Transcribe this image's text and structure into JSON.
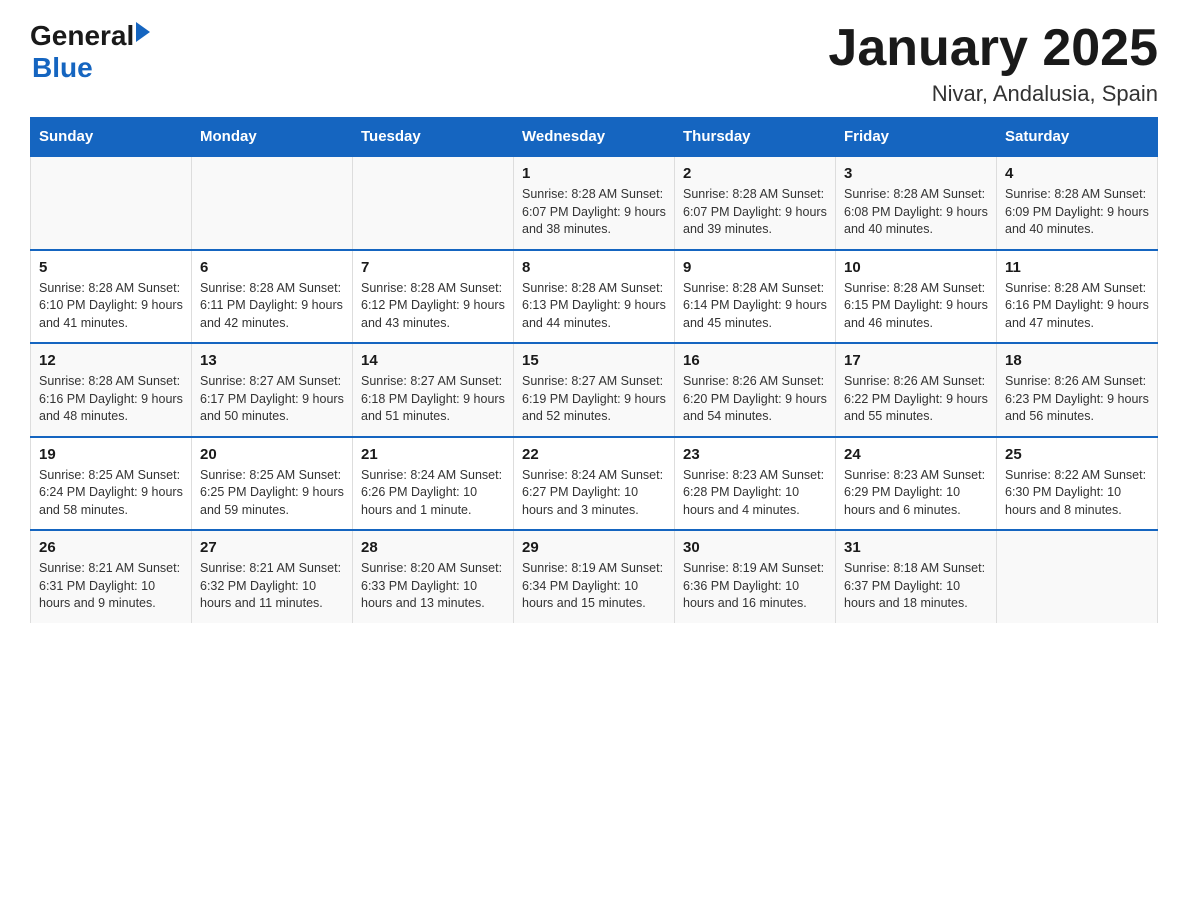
{
  "header": {
    "logo_general": "General",
    "logo_blue": "Blue",
    "title": "January 2025",
    "subtitle": "Nivar, Andalusia, Spain"
  },
  "days_of_week": [
    "Sunday",
    "Monday",
    "Tuesday",
    "Wednesday",
    "Thursday",
    "Friday",
    "Saturday"
  ],
  "weeks": [
    {
      "cells": [
        {
          "day": "",
          "info": ""
        },
        {
          "day": "",
          "info": ""
        },
        {
          "day": "",
          "info": ""
        },
        {
          "day": "1",
          "info": "Sunrise: 8:28 AM\nSunset: 6:07 PM\nDaylight: 9 hours\nand 38 minutes."
        },
        {
          "day": "2",
          "info": "Sunrise: 8:28 AM\nSunset: 6:07 PM\nDaylight: 9 hours\nand 39 minutes."
        },
        {
          "day": "3",
          "info": "Sunrise: 8:28 AM\nSunset: 6:08 PM\nDaylight: 9 hours\nand 40 minutes."
        },
        {
          "day": "4",
          "info": "Sunrise: 8:28 AM\nSunset: 6:09 PM\nDaylight: 9 hours\nand 40 minutes."
        }
      ]
    },
    {
      "cells": [
        {
          "day": "5",
          "info": "Sunrise: 8:28 AM\nSunset: 6:10 PM\nDaylight: 9 hours\nand 41 minutes."
        },
        {
          "day": "6",
          "info": "Sunrise: 8:28 AM\nSunset: 6:11 PM\nDaylight: 9 hours\nand 42 minutes."
        },
        {
          "day": "7",
          "info": "Sunrise: 8:28 AM\nSunset: 6:12 PM\nDaylight: 9 hours\nand 43 minutes."
        },
        {
          "day": "8",
          "info": "Sunrise: 8:28 AM\nSunset: 6:13 PM\nDaylight: 9 hours\nand 44 minutes."
        },
        {
          "day": "9",
          "info": "Sunrise: 8:28 AM\nSunset: 6:14 PM\nDaylight: 9 hours\nand 45 minutes."
        },
        {
          "day": "10",
          "info": "Sunrise: 8:28 AM\nSunset: 6:15 PM\nDaylight: 9 hours\nand 46 minutes."
        },
        {
          "day": "11",
          "info": "Sunrise: 8:28 AM\nSunset: 6:16 PM\nDaylight: 9 hours\nand 47 minutes."
        }
      ]
    },
    {
      "cells": [
        {
          "day": "12",
          "info": "Sunrise: 8:28 AM\nSunset: 6:16 PM\nDaylight: 9 hours\nand 48 minutes."
        },
        {
          "day": "13",
          "info": "Sunrise: 8:27 AM\nSunset: 6:17 PM\nDaylight: 9 hours\nand 50 minutes."
        },
        {
          "day": "14",
          "info": "Sunrise: 8:27 AM\nSunset: 6:18 PM\nDaylight: 9 hours\nand 51 minutes."
        },
        {
          "day": "15",
          "info": "Sunrise: 8:27 AM\nSunset: 6:19 PM\nDaylight: 9 hours\nand 52 minutes."
        },
        {
          "day": "16",
          "info": "Sunrise: 8:26 AM\nSunset: 6:20 PM\nDaylight: 9 hours\nand 54 minutes."
        },
        {
          "day": "17",
          "info": "Sunrise: 8:26 AM\nSunset: 6:22 PM\nDaylight: 9 hours\nand 55 minutes."
        },
        {
          "day": "18",
          "info": "Sunrise: 8:26 AM\nSunset: 6:23 PM\nDaylight: 9 hours\nand 56 minutes."
        }
      ]
    },
    {
      "cells": [
        {
          "day": "19",
          "info": "Sunrise: 8:25 AM\nSunset: 6:24 PM\nDaylight: 9 hours\nand 58 minutes."
        },
        {
          "day": "20",
          "info": "Sunrise: 8:25 AM\nSunset: 6:25 PM\nDaylight: 9 hours\nand 59 minutes."
        },
        {
          "day": "21",
          "info": "Sunrise: 8:24 AM\nSunset: 6:26 PM\nDaylight: 10 hours\nand 1 minute."
        },
        {
          "day": "22",
          "info": "Sunrise: 8:24 AM\nSunset: 6:27 PM\nDaylight: 10 hours\nand 3 minutes."
        },
        {
          "day": "23",
          "info": "Sunrise: 8:23 AM\nSunset: 6:28 PM\nDaylight: 10 hours\nand 4 minutes."
        },
        {
          "day": "24",
          "info": "Sunrise: 8:23 AM\nSunset: 6:29 PM\nDaylight: 10 hours\nand 6 minutes."
        },
        {
          "day": "25",
          "info": "Sunrise: 8:22 AM\nSunset: 6:30 PM\nDaylight: 10 hours\nand 8 minutes."
        }
      ]
    },
    {
      "cells": [
        {
          "day": "26",
          "info": "Sunrise: 8:21 AM\nSunset: 6:31 PM\nDaylight: 10 hours\nand 9 minutes."
        },
        {
          "day": "27",
          "info": "Sunrise: 8:21 AM\nSunset: 6:32 PM\nDaylight: 10 hours\nand 11 minutes."
        },
        {
          "day": "28",
          "info": "Sunrise: 8:20 AM\nSunset: 6:33 PM\nDaylight: 10 hours\nand 13 minutes."
        },
        {
          "day": "29",
          "info": "Sunrise: 8:19 AM\nSunset: 6:34 PM\nDaylight: 10 hours\nand 15 minutes."
        },
        {
          "day": "30",
          "info": "Sunrise: 8:19 AM\nSunset: 6:36 PM\nDaylight: 10 hours\nand 16 minutes."
        },
        {
          "day": "31",
          "info": "Sunrise: 8:18 AM\nSunset: 6:37 PM\nDaylight: 10 hours\nand 18 minutes."
        },
        {
          "day": "",
          "info": ""
        }
      ]
    }
  ]
}
